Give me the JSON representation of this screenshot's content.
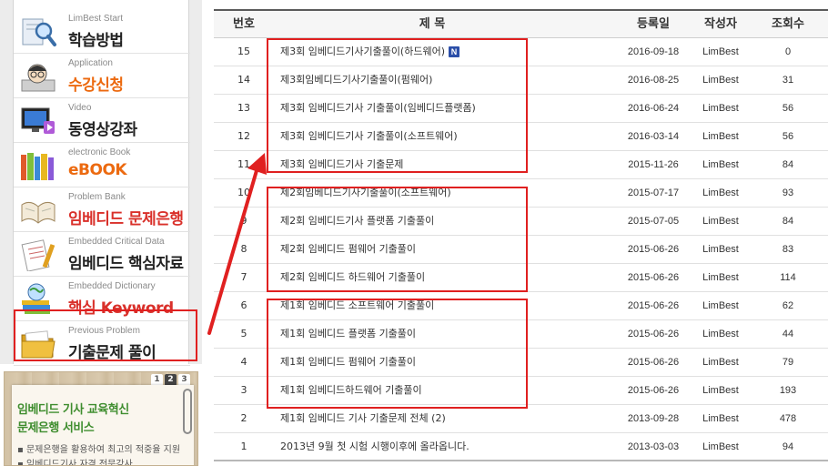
{
  "sidebar": {
    "items": [
      {
        "sub": "LimBest Start",
        "label": "학습방법",
        "color": "dark",
        "icon": "magnifier-search-icon"
      },
      {
        "sub": "Application",
        "label": "수강신청",
        "color": "orange",
        "icon": "student-avatar-icon"
      },
      {
        "sub": "Video",
        "label": "동영상강좌",
        "color": "dark",
        "icon": "video-monitor-icon"
      },
      {
        "sub": "electronic Book",
        "label": "eBOOK",
        "color": "orange",
        "icon": "books-icon"
      },
      {
        "sub": "Problem Bank",
        "label": "임베디드 문제은행",
        "color": "red",
        "icon": "open-book-icon"
      },
      {
        "sub": "Embedded Critical Data",
        "label": "임베디드 핵심자료",
        "color": "dark",
        "icon": "document-pencil-icon"
      },
      {
        "sub": "Embedded Dictionary",
        "label": "핵심 Keyword",
        "color": "red",
        "icon": "globe-books-icon"
      },
      {
        "sub": "Previous Problem",
        "label": "기출문제 풀이",
        "color": "dark",
        "icon": "folder-icon"
      }
    ]
  },
  "promo": {
    "title_line1": "임베디드 기사 교육혁신",
    "title_line2": "문제은행 서비스",
    "bullet1": "▪ 문제은행을 활용하여 최고의 적중율 지원",
    "bullet2": "▪ 임베디드기사 자격 전문강사",
    "pages": [
      "1",
      "2",
      "3"
    ],
    "active_page": "2"
  },
  "board": {
    "columns": {
      "num": "번호",
      "title": "제 목",
      "date": "등록일",
      "author": "작성자",
      "views": "조회수"
    },
    "rows": [
      {
        "num": "15",
        "title": "제3회 임베디드기사기출풀이(하드웨어)",
        "date": "2016-09-18",
        "author": "LimBest",
        "views": "0",
        "new": "N"
      },
      {
        "num": "14",
        "title": "제3회임베디드기사기출풀이(펌웨어)",
        "date": "2016-08-25",
        "author": "LimBest",
        "views": "31"
      },
      {
        "num": "13",
        "title": "제3회 임베디드기사 기출풀이(임베디드플랫폼)",
        "date": "2016-06-24",
        "author": "LimBest",
        "views": "56"
      },
      {
        "num": "12",
        "title": "제3회 임베디드기사 기출풀이(소프트웨어)",
        "date": "2016-03-14",
        "author": "LimBest",
        "views": "56"
      },
      {
        "num": "11",
        "title": "제3회 임베디드기사 기출문제",
        "date": "2015-11-26",
        "author": "LimBest",
        "views": "84"
      },
      {
        "num": "10",
        "title": "제2회임베디드기사기출풀이(소프트웨어)",
        "date": "2015-07-17",
        "author": "LimBest",
        "views": "93"
      },
      {
        "num": "9",
        "title": "제2회 임베디드기사 플랫폼 기출풀이",
        "date": "2015-07-05",
        "author": "LimBest",
        "views": "84"
      },
      {
        "num": "8",
        "title": "제2회 임베디드 펌웨어 기출풀이",
        "date": "2015-06-26",
        "author": "LimBest",
        "views": "83"
      },
      {
        "num": "7",
        "title": "제2회 임베디드 하드웨어 기출풀이",
        "date": "2015-06-26",
        "author": "LimBest",
        "views": "114"
      },
      {
        "num": "6",
        "title": "제1회 임베디드 소프트웨어 기출풀이",
        "date": "2015-06-26",
        "author": "LimBest",
        "views": "62"
      },
      {
        "num": "5",
        "title": "제1회 임베디드 플랫폼 기출풀이",
        "date": "2015-06-26",
        "author": "LimBest",
        "views": "44"
      },
      {
        "num": "4",
        "title": "제1회 임베디드 펌웨어 기출풀이",
        "date": "2015-06-26",
        "author": "LimBest",
        "views": "79"
      },
      {
        "num": "3",
        "title": "제1회 임베디드하드웨어 기출풀이",
        "date": "2015-06-26",
        "author": "LimBest",
        "views": "193"
      },
      {
        "num": "2",
        "title": "제1회 임베디드 기사 기출문제 전체 (2)",
        "date": "2013-09-28",
        "author": "LimBest",
        "views": "478"
      },
      {
        "num": "1",
        "title": "2013년 9월 첫 시험 시행이후에 올라옵니다.",
        "date": "2013-03-03",
        "author": "LimBest",
        "views": "94"
      }
    ]
  },
  "colors": {
    "annotation": "#e02020",
    "orange_label": "#ec6a10",
    "red_label": "#d9302a",
    "new_badge": "#2b4ea8"
  }
}
